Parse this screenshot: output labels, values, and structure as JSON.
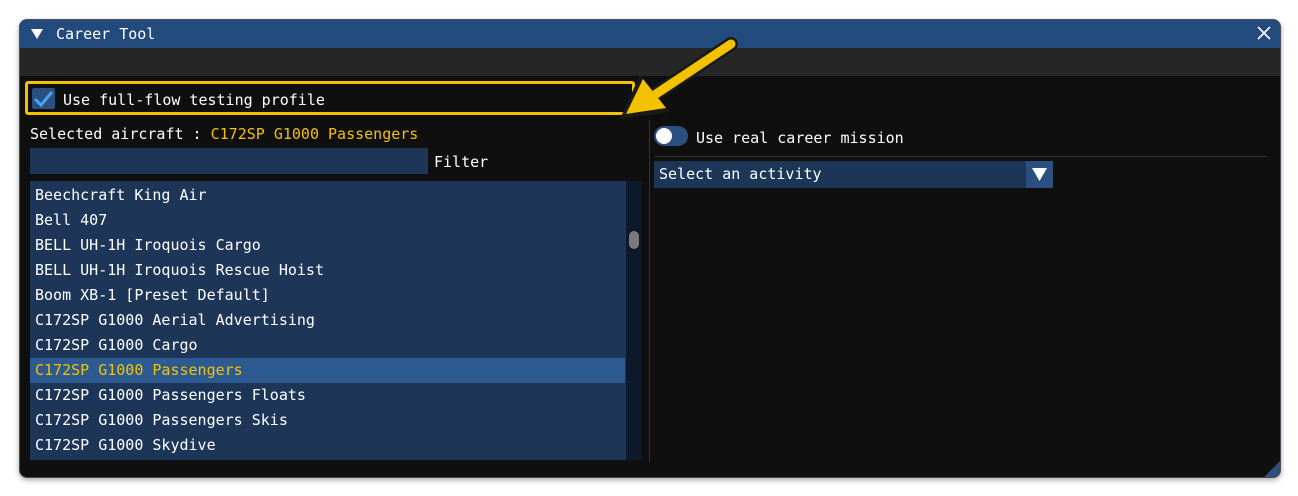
{
  "window": {
    "title": "Career Tool"
  },
  "profile": {
    "label": "Use full-flow testing profile",
    "checked": true
  },
  "aircraft": {
    "selected_prefix": "Selected aircraft : ",
    "selected_value": "C172SP G1000 Passengers",
    "filter_label": "Filter",
    "filter_value": "",
    "items": [
      "Beechcraft King Air",
      "Bell 407",
      "BELL UH-1H Iroquois Cargo",
      "BELL UH-1H Iroquois Rescue Hoist",
      "Boom XB-1 [Preset Default]",
      "C172SP G1000 Aerial Advertising",
      "C172SP G1000 Cargo",
      "C172SP G1000 Passengers",
      "C172SP G1000 Passengers Floats",
      "C172SP G1000 Passengers Skis",
      "C172SP G1000 Skydive"
    ],
    "selected_index": 7
  },
  "career": {
    "toggle_label": "Use real career mission",
    "toggle_on": false
  },
  "activity": {
    "value": "Select an activity"
  },
  "colors": {
    "highlight": "#f2c200",
    "titlebar": "#234a7c",
    "panel": "#1d3557",
    "accent": "#2b4f7f"
  }
}
